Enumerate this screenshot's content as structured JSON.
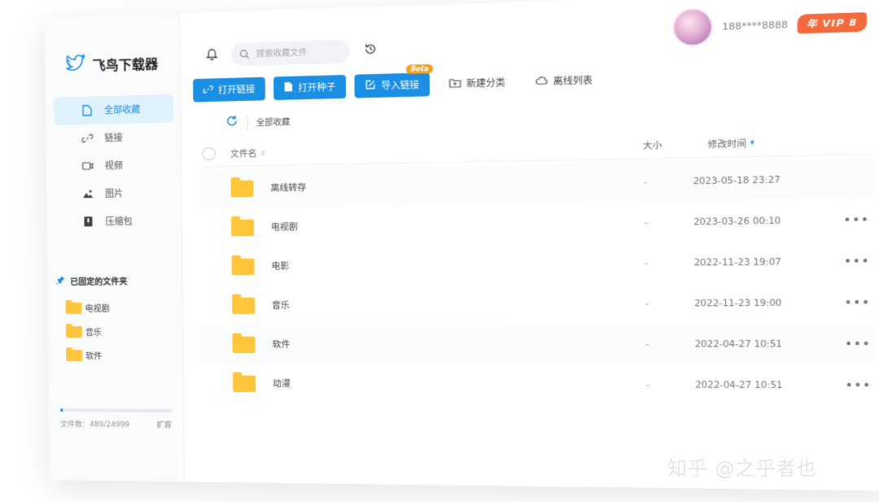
{
  "app": {
    "title": "飞鸟下载器"
  },
  "sidebar": {
    "items": [
      {
        "label": "全部收藏",
        "icon": "file-icon",
        "active": true
      },
      {
        "label": "链接",
        "icon": "link-icon"
      },
      {
        "label": "视频",
        "icon": "video-icon"
      },
      {
        "label": "图片",
        "icon": "image-icon"
      },
      {
        "label": "压缩包",
        "icon": "archive-icon"
      }
    ],
    "pinned_title": "已固定的文件夹",
    "pinned": [
      "电视剧",
      "音乐",
      "软件"
    ],
    "storage": {
      "text": "文件数：489/24999",
      "used": 489,
      "total": 24999,
      "expand_label": "扩容"
    }
  },
  "header": {
    "search_placeholder": "搜索收藏文件",
    "phone": "188****8888",
    "vip": "年 VIP 8"
  },
  "toolbar": {
    "open_link": "打开链接",
    "open_seed": "打开种子",
    "import_link": "导入链接",
    "beta": "Beta",
    "new_category": "新建分类",
    "offline_list": "离线列表"
  },
  "breadcrumb": {
    "current": "全部收藏"
  },
  "table": {
    "headers": {
      "name": "文件名",
      "size": "大小",
      "time": "修改时间"
    },
    "rows": [
      {
        "name": "离线转存",
        "size": "-",
        "time": "2023-05-18 23:27"
      },
      {
        "name": "电视剧",
        "size": "-",
        "time": "2023-03-26 00:10"
      },
      {
        "name": "电影",
        "size": "-",
        "time": "2022-11-23 19:07"
      },
      {
        "name": "音乐",
        "size": "-",
        "time": "2022-11-23 19:00"
      },
      {
        "name": "软件",
        "size": "-",
        "time": "2022-04-27 10:51"
      },
      {
        "name": "动漫",
        "size": "-",
        "time": "2022-04-27 10:51"
      }
    ]
  },
  "watermark": "知乎 @之乎者也",
  "colors": {
    "accent": "#1a8fe3",
    "vip": "#f26a3d",
    "folder": "#ffc53d",
    "beta": "#f7a01b"
  }
}
